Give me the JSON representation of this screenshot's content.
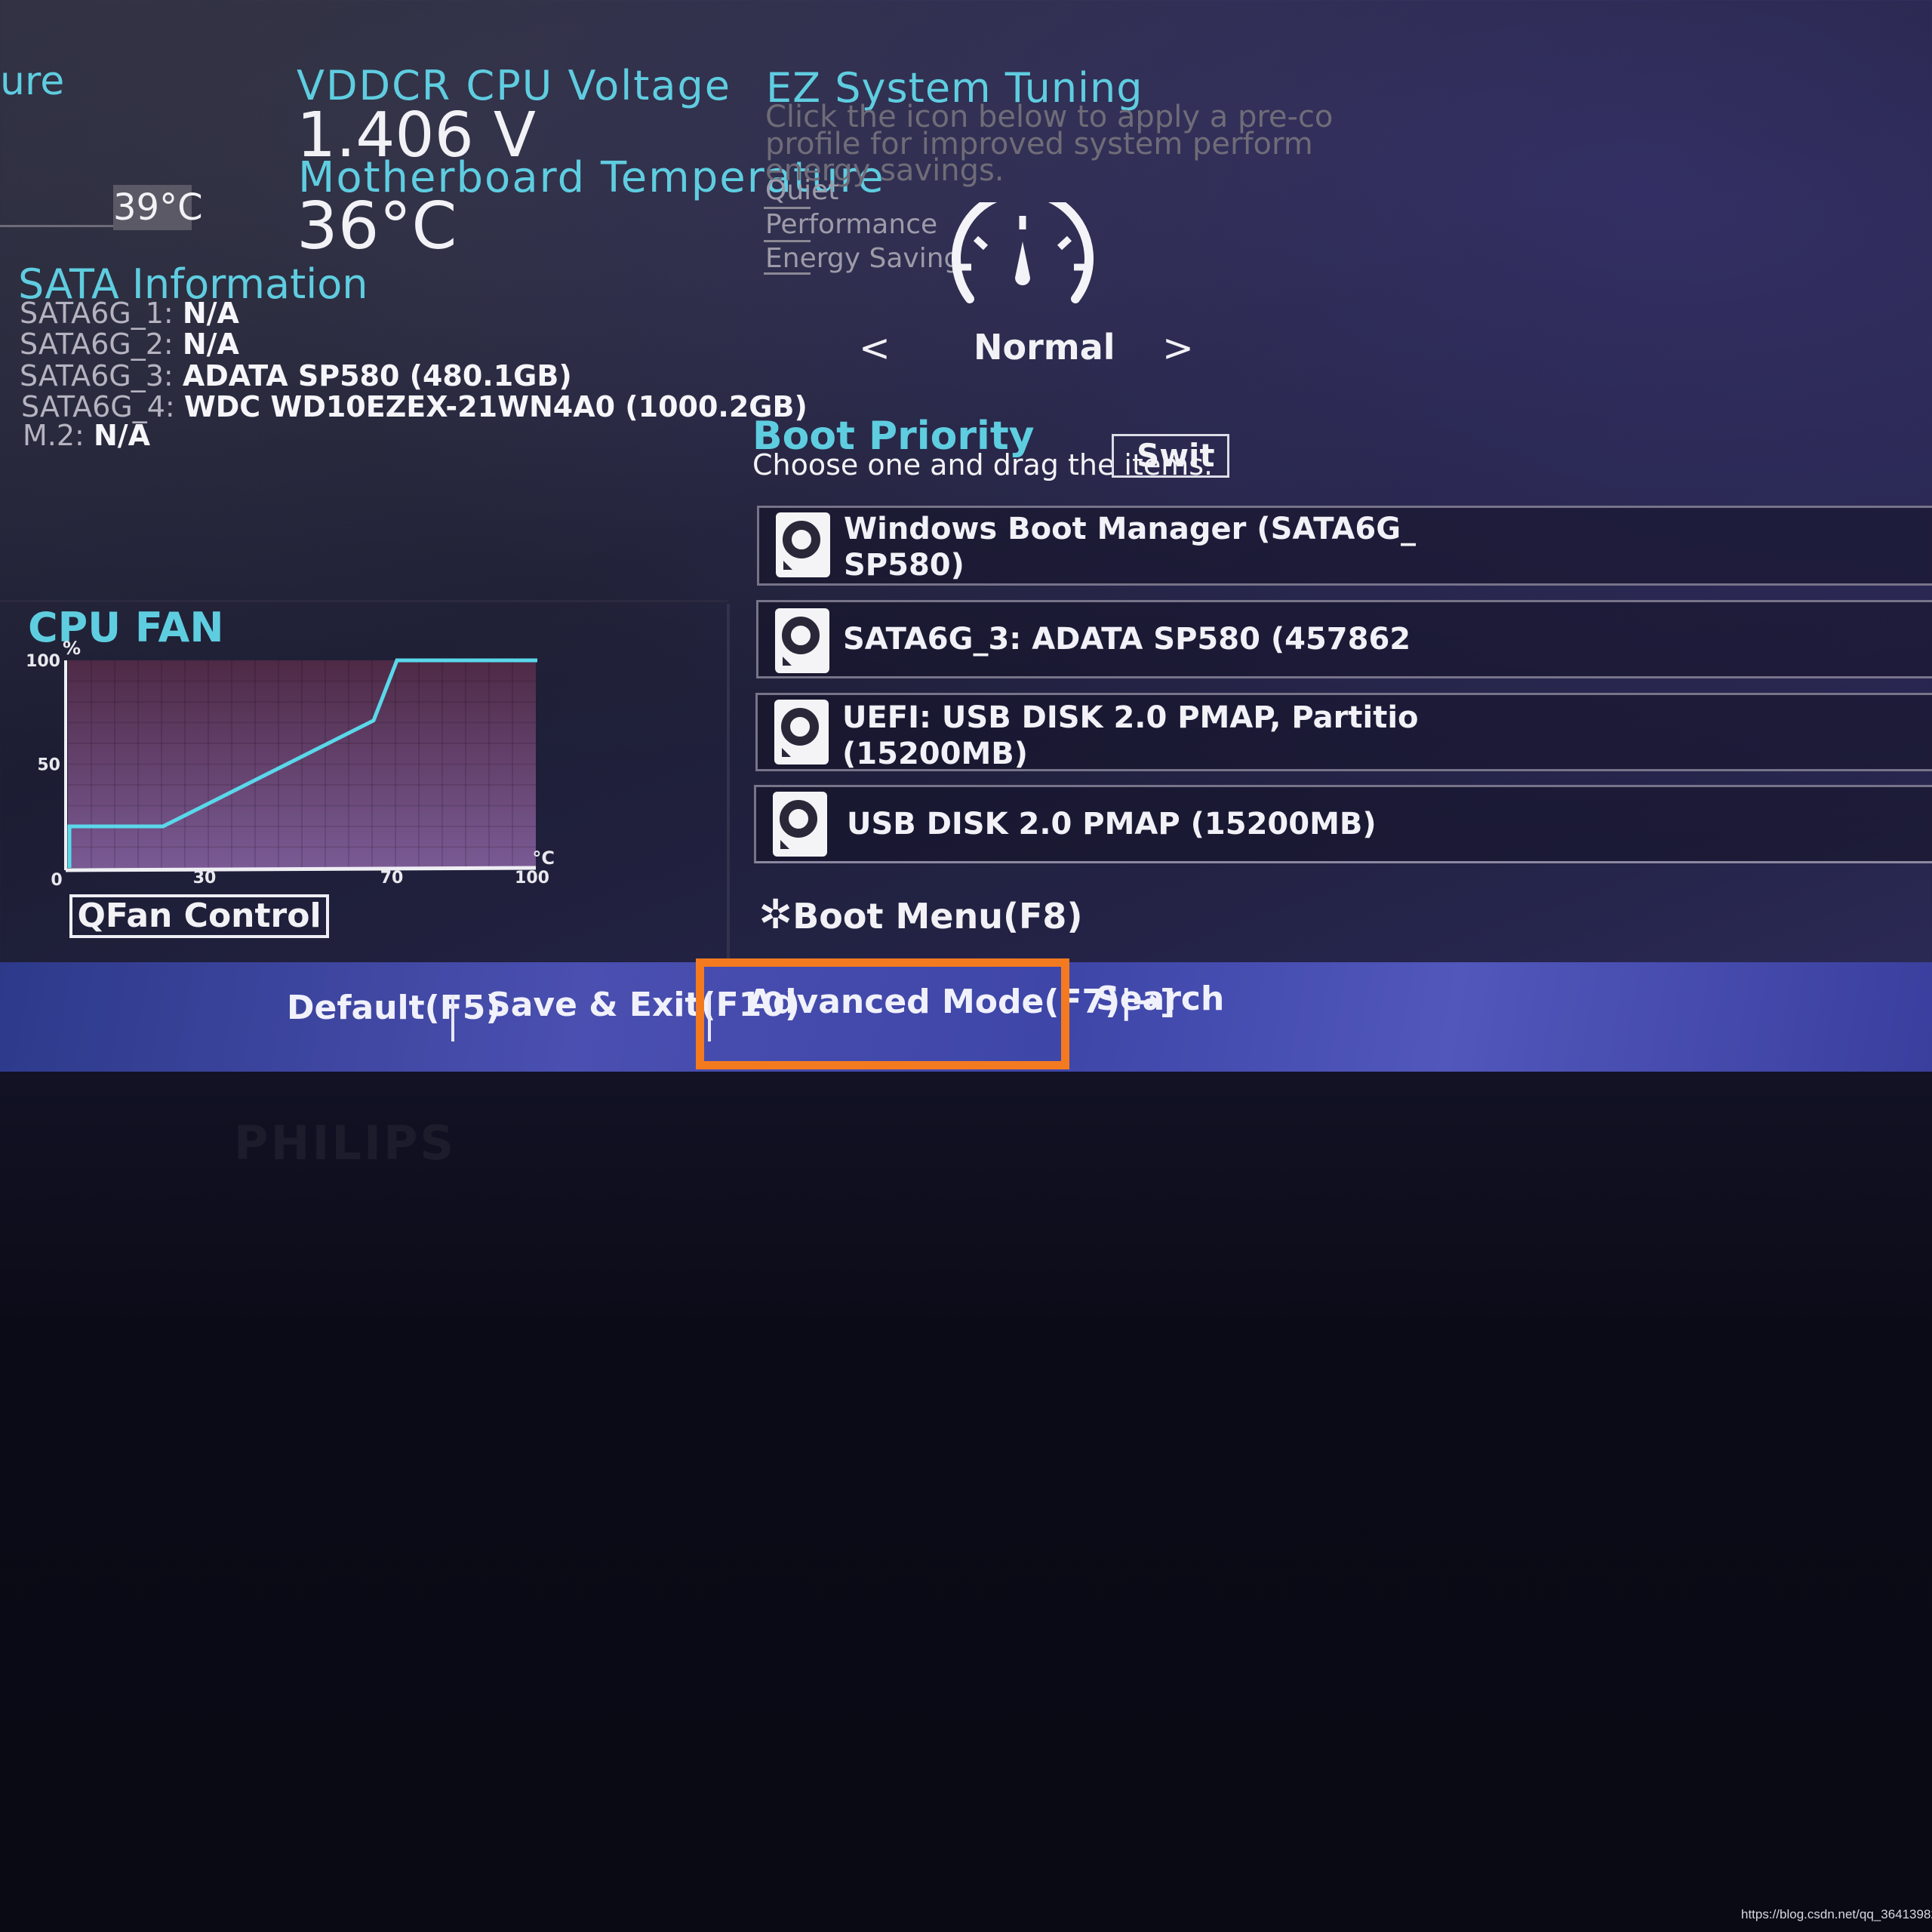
{
  "left_top": {
    "title_fragment": "ure",
    "temp_value": "39°C"
  },
  "voltage": {
    "label": "VDDCR CPU Voltage",
    "value": "1.406 V"
  },
  "mb_temp": {
    "label": "Motherboard Temperature",
    "value": "36°C"
  },
  "sata": {
    "title": "SATA Information",
    "rows": [
      {
        "label": "SATA6G_1:",
        "value": "N/A"
      },
      {
        "label": "SATA6G_2:",
        "value": "N/A"
      },
      {
        "label": "SATA6G_3:",
        "value": "ADATA SP580 (480.1GB)"
      },
      {
        "label": "SATA6G_4:",
        "value": "WDC WD10EZEX-21WN4A0 (1000.2GB)"
      },
      {
        "label": "M.2:",
        "value": "N/A"
      }
    ]
  },
  "ez_tuning": {
    "title": "EZ System Tuning",
    "description": [
      "Click the icon below to apply a pre-co",
      "profile for improved system perform",
      "energy savings."
    ],
    "options": [
      "Quiet",
      "Performance",
      "Energy Saving"
    ],
    "current_profile": "Normal",
    "prev_label": "<",
    "next_label": ">",
    "icon": "speedometer-icon"
  },
  "boot": {
    "title": "Boot Priority",
    "subtitle": "Choose one and drag the items.",
    "switch_label": "Swit",
    "items": [
      {
        "line1": "Windows Boot Manager (SATA6G_",
        "line2": "SP580)"
      },
      {
        "line1": "SATA6G_3: ADATA SP580  (457862",
        "line2": ""
      },
      {
        "line1": "UEFI:  USB DISK 2.0 PMAP, Partitio",
        "line2": "(15200MB)"
      },
      {
        "line1": "USB DISK 2.0 PMAP  (15200MB)",
        "line2": ""
      }
    ],
    "boot_menu_label": "Boot Menu(F8)"
  },
  "cpu_fan": {
    "title": "CPU FAN",
    "qfan_label": "QFan Control"
  },
  "chart_data": {
    "type": "line",
    "title": "CPU FAN",
    "xlabel": "°C",
    "ylabel": "%",
    "xlim": [
      0,
      100
    ],
    "ylim": [
      0,
      100
    ],
    "origin_label": "0",
    "x_ticks": [
      "30",
      "70",
      "100"
    ],
    "y_ticks": [
      "50",
      "100"
    ],
    "grid": true,
    "series": [
      {
        "x": [
          0,
          0,
          20,
          65,
          70,
          100
        ],
        "y": [
          0,
          20,
          20,
          71,
          100,
          100
        ]
      }
    ],
    "colors": {
      "line": "#5ad8ea",
      "plot_bg": "#5a3a5e"
    }
  },
  "bottom_bar": {
    "default_label": "Default(F5)",
    "save_exit_label": "Save & Exit(F10)",
    "advanced_label": "Advanced Mode(F7)|→]",
    "search_label": "Search"
  },
  "highlight_color": "#f47a20",
  "monitor_brand": "PHILIPS",
  "watermark": "https://blog.csdn.net/qq_36413982"
}
